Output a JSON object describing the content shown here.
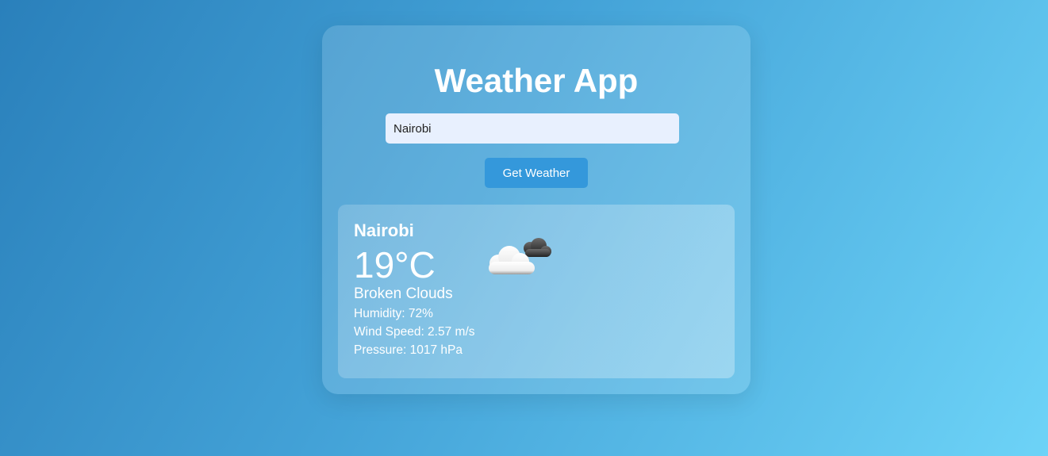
{
  "app": {
    "title": "Weather App"
  },
  "search": {
    "value": "Nairobi",
    "button_label": "Get Weather"
  },
  "weather": {
    "city": "Nairobi",
    "temperature": "19°C",
    "description": "Broken Clouds",
    "humidity": "Humidity: 72%",
    "wind_speed": "Wind Speed: 2.57 m/s",
    "pressure": "Pressure: 1017 hPa",
    "icon": "broken-clouds-icon"
  },
  "colors": {
    "accent_button": "#3498db",
    "input_background": "#e8f0fe"
  }
}
